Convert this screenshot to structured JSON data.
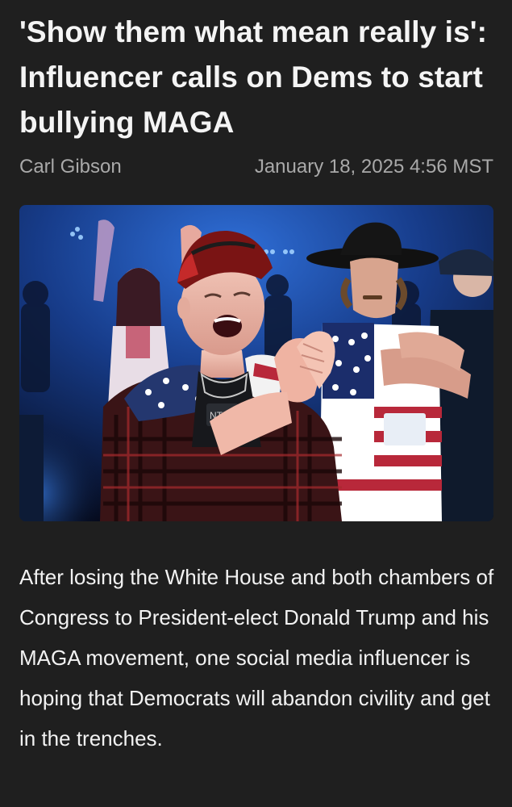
{
  "article": {
    "headline": "'Show them what mean really is': Influencer calls on Dems to start bullying MAGA",
    "author": "Carl Gibson",
    "date": "January 18, 2025 4:56 MST",
    "image": {
      "subject": "crowd-photo",
      "badge_text": "NTI"
    },
    "body": "After losing the White House and both chambers of Congress to President-elect Donald Trump and his MAGA movement, one social media influencer is hoping that Democrats will abandon civility and get in the trenches."
  },
  "colors": {
    "background": "#1f1f1f",
    "headline": "#f4f4f4",
    "byline": "#a9a9a9",
    "body": "#f2f2f2"
  }
}
